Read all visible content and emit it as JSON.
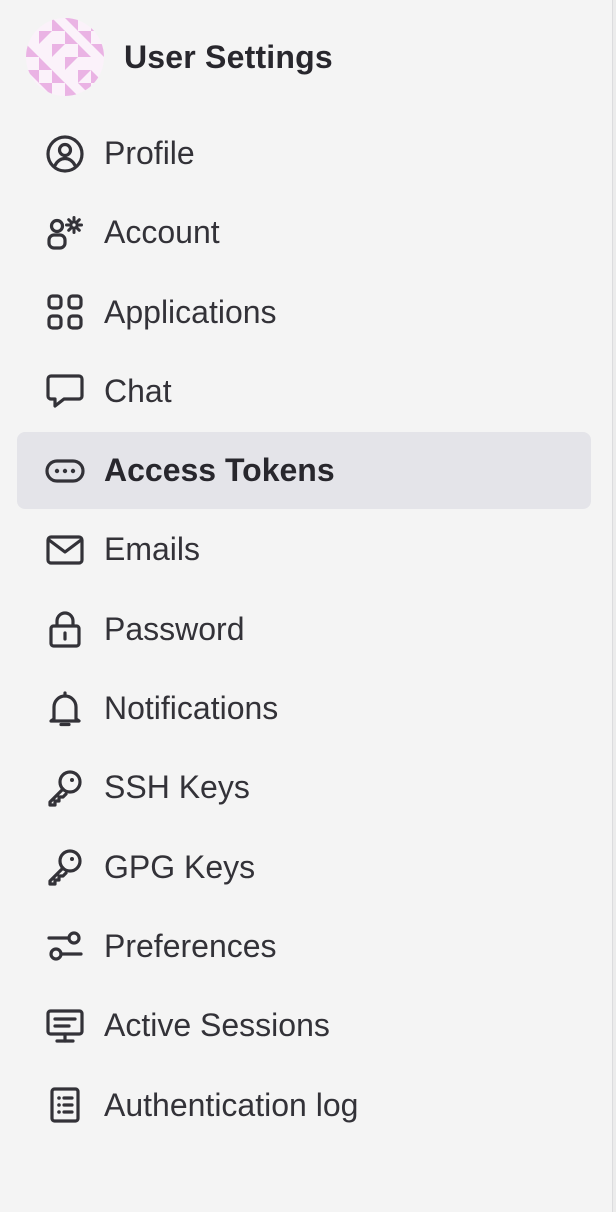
{
  "sidebar": {
    "title": "User Settings",
    "active_item": "Access Tokens",
    "items": [
      {
        "label": "Profile",
        "icon": "profile-icon"
      },
      {
        "label": "Account",
        "icon": "account-icon"
      },
      {
        "label": "Applications",
        "icon": "applications-icon"
      },
      {
        "label": "Chat",
        "icon": "chat-icon"
      },
      {
        "label": "Access Tokens",
        "icon": "token-icon"
      },
      {
        "label": "Emails",
        "icon": "mail-icon"
      },
      {
        "label": "Password",
        "icon": "lock-icon"
      },
      {
        "label": "Notifications",
        "icon": "bell-icon"
      },
      {
        "label": "SSH Keys",
        "icon": "key-icon"
      },
      {
        "label": "GPG Keys",
        "icon": "key-icon"
      },
      {
        "label": "Preferences",
        "icon": "preferences-icon"
      },
      {
        "label": "Active Sessions",
        "icon": "monitor-icon"
      },
      {
        "label": "Authentication log",
        "icon": "log-icon"
      }
    ]
  },
  "colors": {
    "background": "#f4f4f4",
    "active_background": "#e4e4e9",
    "text": "#333238",
    "avatar_pattern": "#eab3e4"
  }
}
